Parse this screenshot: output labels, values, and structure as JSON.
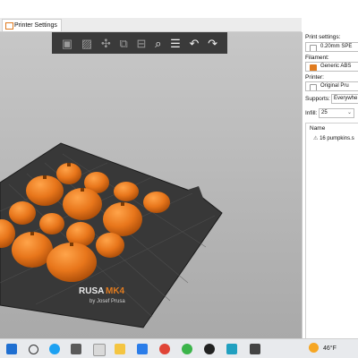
{
  "tab": {
    "label": "Printer Settings"
  },
  "toolbar": {
    "icons": [
      "add",
      "delete",
      "arrange",
      "copy",
      "paste",
      "search",
      "layers",
      "undo",
      "redo"
    ]
  },
  "sidebar": {
    "print_settings_label": "Print settings:",
    "print_settings_value": "0.20mm SPE",
    "filament_label": "Filament:",
    "filament_value": "Generic ABS",
    "printer_label": "Printer:",
    "printer_value": "Original Pru",
    "supports_label": "Supports:",
    "supports_value": "Everywhe",
    "infill_label": "Infill:",
    "infill_value": "25",
    "name_header": "Name",
    "object_name": "16 pumpkins.s"
  },
  "bed": {
    "brand": "RUSA",
    "model": "MK4",
    "subtitle": "by Josef Prusa"
  },
  "taskbar": {
    "temperature": "46°F"
  },
  "colors": {
    "pumpkin": "#e8761b",
    "bed": "#3b3b3b",
    "accent": "#e07b1f"
  }
}
